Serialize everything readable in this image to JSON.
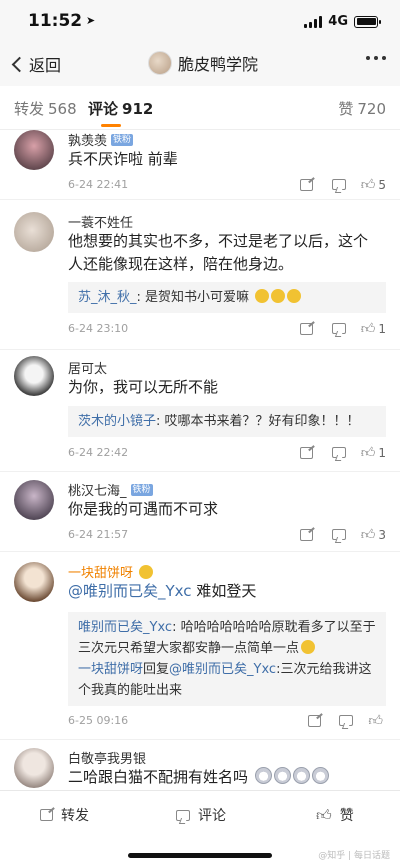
{
  "status_bar": {
    "time": "11:52",
    "location_arrow": "location-arrow-icon",
    "network": "4G"
  },
  "nav": {
    "back_label": "返回",
    "title": "脆皮鸭学院",
    "more_icon": "more-icon"
  },
  "tabs": [
    {
      "label": "转发",
      "count": "568"
    },
    {
      "label": "评论",
      "count": "912"
    },
    {
      "label": "赞",
      "count": "720"
    }
  ],
  "comments": [
    {
      "name": "孰羡羡",
      "badge": "铁粉",
      "text": "兵不厌诈啦 前辈",
      "date": "6-24 22:41",
      "likes": "5"
    },
    {
      "name": "一蓑不姓任",
      "text": "他想要的其实也不多，不过是老了以后，这个人还能像现在这样，陪在他身边。",
      "reply_name": "苏_沐_秋_",
      "reply_text": "是贺知书小可爱嘛",
      "date": "6-24 23:10",
      "likes": "1"
    },
    {
      "name": "居可太",
      "text": "为你，我可以无所不能",
      "reply_name": "茨木的小镜子",
      "reply_text": "哎哪本书来着？？好有印象！！！",
      "date": "6-24 22:42",
      "likes": "1"
    },
    {
      "name": "桃汉七海_",
      "badge": "铁粉",
      "text": "你是我的可遇而不可求",
      "date": "6-24 21:57",
      "likes": "3"
    },
    {
      "name": "一块甜饼呀",
      "mention": "@唯别而已矣_Yxc",
      "text": "难如登天",
      "reply1_name": "唯别而已矣_Yxc",
      "reply1_text": "哈哈哈哈哈哈哈原耽看多了以至于三次元只希望大家都安静一点简单一点",
      "reply2_name": "一块甜饼呀",
      "reply2_mid": "回复",
      "reply2_mention": "@唯别而已矣_Yxc",
      "reply2_text": ":三次元给我讲这个我真的能吐出来",
      "date": "6-25 09:16",
      "likes": ""
    },
    {
      "name": "白敬亭我男银",
      "text": "二哈跟白猫不配拥有姓名吗"
    }
  ],
  "bottom_bar": {
    "repost": "转发",
    "comment": "评论",
    "like": "赞"
  },
  "watermark": "@知乎 | 每日话题"
}
